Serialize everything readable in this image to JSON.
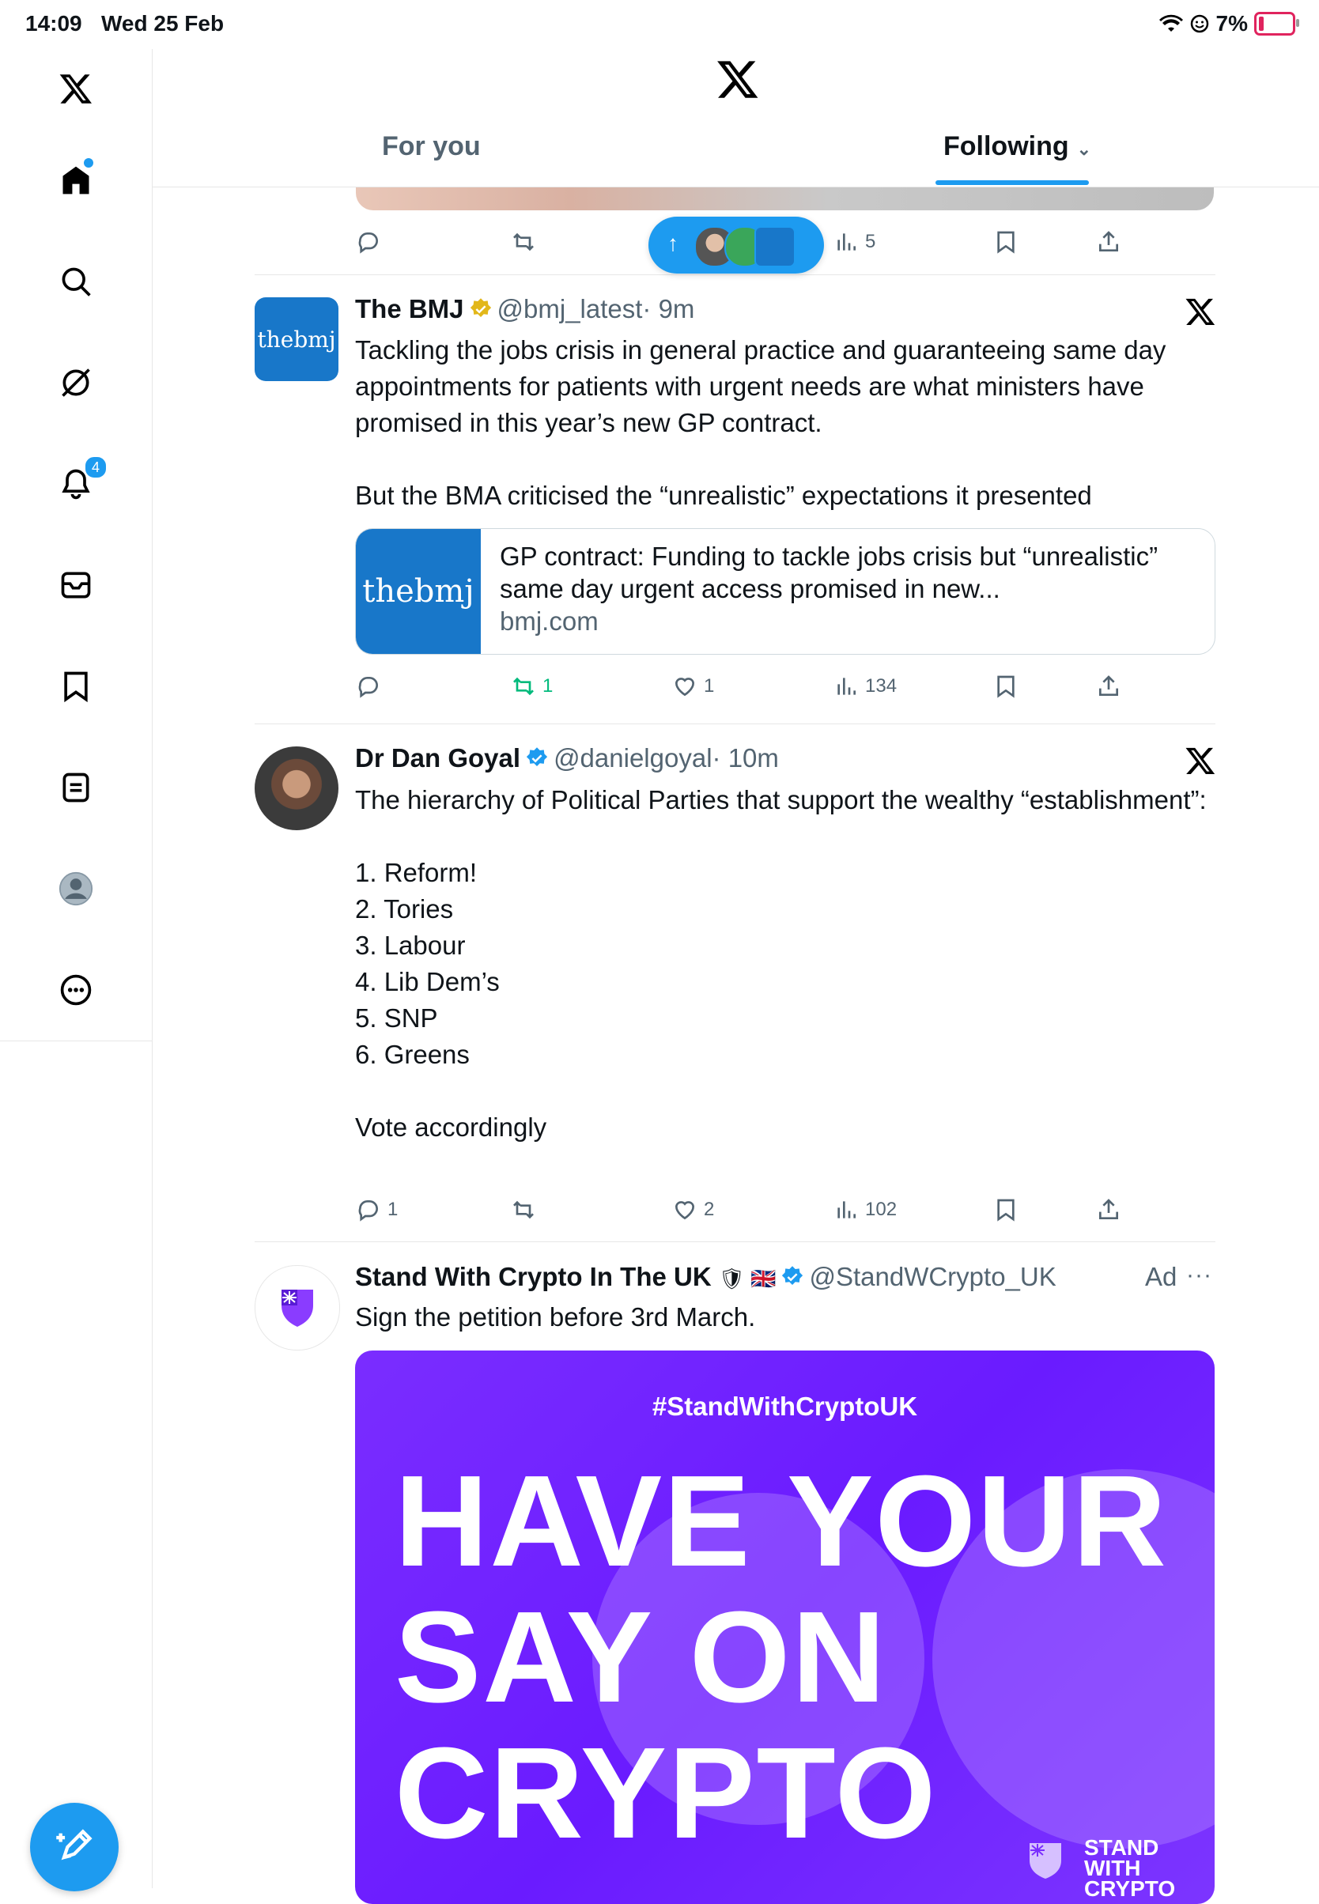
{
  "status_bar": {
    "time": "14:09",
    "date": "Wed 25 Feb",
    "battery": "7%"
  },
  "sidebar": {
    "items": [
      {
        "name": "home",
        "icon": "home-icon"
      },
      {
        "name": "explore",
        "icon": "search-icon"
      },
      {
        "name": "grok",
        "icon": "grok-icon"
      },
      {
        "name": "notifications",
        "icon": "bell-icon",
        "badge": "4"
      },
      {
        "name": "messages",
        "icon": "envelope-icon"
      },
      {
        "name": "bookmarks",
        "icon": "bookmark-icon"
      },
      {
        "name": "lists",
        "icon": "list-icon"
      },
      {
        "name": "profile",
        "icon": "avatar-icon"
      },
      {
        "name": "more",
        "icon": "more-icon"
      }
    ]
  },
  "header": {
    "tabs": [
      {
        "label": "For you"
      },
      {
        "label": "Following"
      }
    ]
  },
  "previous_tweet": {
    "views": "5"
  },
  "tweets": [
    {
      "name": "The BMJ",
      "handle": "@bmj_latest",
      "time": "· 9m",
      "avatar_text": "thebmj",
      "text": "Tackling the jobs crisis in general practice and guaranteeing same day appointments for patients with urgent needs are what ministers have promised in this year’s new GP contract.\n\nBut the BMA criticised the “unrealistic” expectations it presented",
      "card": {
        "thumb_text": "thebmj",
        "title": "GP contract: Funding to tackle jobs crisis but “unrealistic” same day urgent access promised in new...",
        "domain": "bmj.com"
      },
      "replies": "",
      "reposts": "1",
      "likes": "1",
      "views": "134"
    },
    {
      "name": "Dr Dan Goyal",
      "handle": "@danielgoyal",
      "time": "· 10m",
      "text": "The hierarchy of Political Parties that support the wealthy “establishment”:\n\n1. Reform!\n2. Tories\n3. Labour\n4. Lib Dem’s\n5. SNP\n6. Greens\n\nVote accordingly",
      "replies": "1",
      "reposts": "",
      "likes": "2",
      "views": "102"
    },
    {
      "name": "Stand With Crypto In The UK",
      "flags": "🛡 🇬🇧",
      "handle": "@StandWCrypto_UK",
      "ad_label": "Ad",
      "more_label": "···",
      "text": "Sign the petition before 3rd March.",
      "image": {
        "hashtag": "#StandWithCryptoUK",
        "headline_lines": [
          "HAVE YOUR",
          "SAY ON",
          "CRYPTO"
        ],
        "brand_lines": [
          "STAND",
          "WITH",
          "CRYPTO"
        ]
      }
    }
  ],
  "colors": {
    "accent": "#1d9bf0",
    "repost_active": "#00ba7c",
    "ad_purple": "#6a1bff"
  }
}
